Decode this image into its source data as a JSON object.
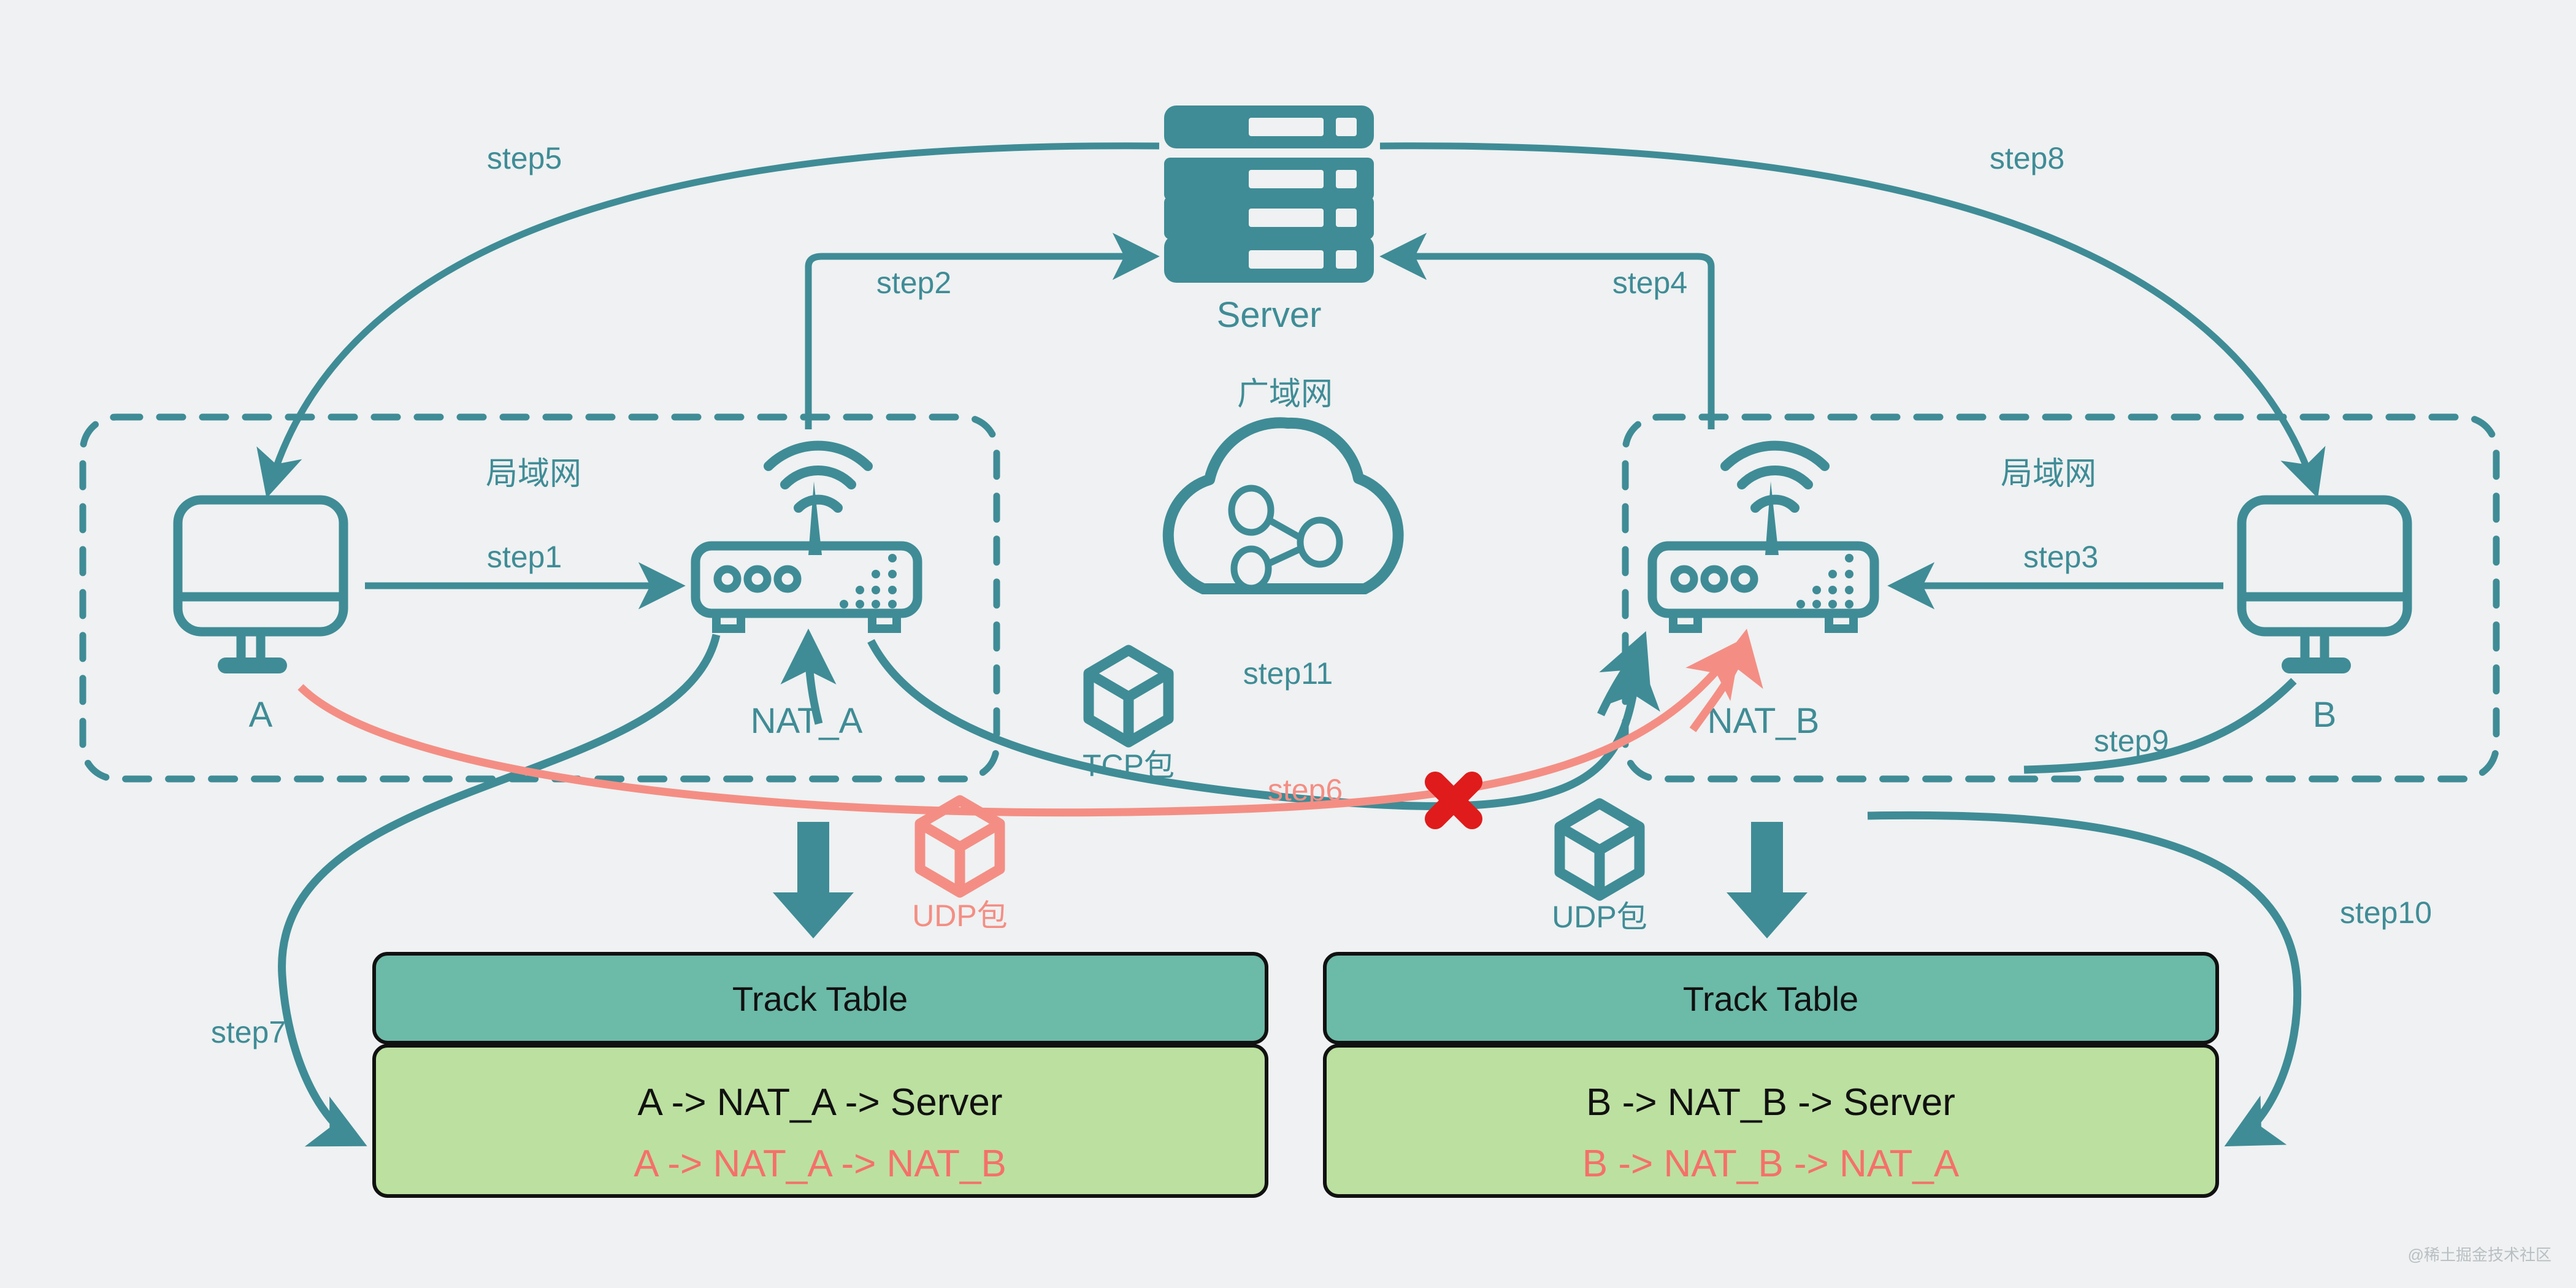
{
  "theme": {
    "background": "#eff1f2",
    "teal": "#3f8c96",
    "teal_line": "#3f8c96",
    "pink": "#f48e84",
    "red_x": "#e01b1b",
    "table_header_bg": "#6cbaa8",
    "table_body_bg": "#bce0a0",
    "table_border": "#111111",
    "table_red_text": "#f5706a",
    "table_black_text": "#111111",
    "watermark_color": "#b9bec2"
  },
  "nodes": {
    "server_label": "Server",
    "client_a_label": "A",
    "client_b_label": "B",
    "nat_a_label": "NAT_A",
    "nat_b_label": "NAT_B",
    "lan_left_label": "局域网",
    "lan_right_label": "局域网",
    "wan_label": "广域网"
  },
  "packets": {
    "tcp_label": "TCP包",
    "udp_left_label": "UDP包",
    "udp_right_label": "UDP包"
  },
  "steps": {
    "step1": "step1",
    "step2": "step2",
    "step3": "step3",
    "step4": "step4",
    "step5": "step5",
    "step6": "step6",
    "step7": "step7",
    "step8": "step8",
    "step9": "step9",
    "step10": "step10",
    "step11": "step11"
  },
  "tables": [
    {
      "header": "Track Table",
      "rows": [
        {
          "text": "A -> NAT_A -> Server",
          "color": "black"
        },
        {
          "text": "A -> NAT_A -> NAT_B",
          "color": "red"
        }
      ]
    },
    {
      "header": "Track Table",
      "rows": [
        {
          "text": "B -> NAT_B -> Server",
          "color": "black"
        },
        {
          "text": "B -> NAT_B -> NAT_A",
          "color": "red"
        }
      ]
    }
  ],
  "watermark": "@稀土掘金技术社区"
}
